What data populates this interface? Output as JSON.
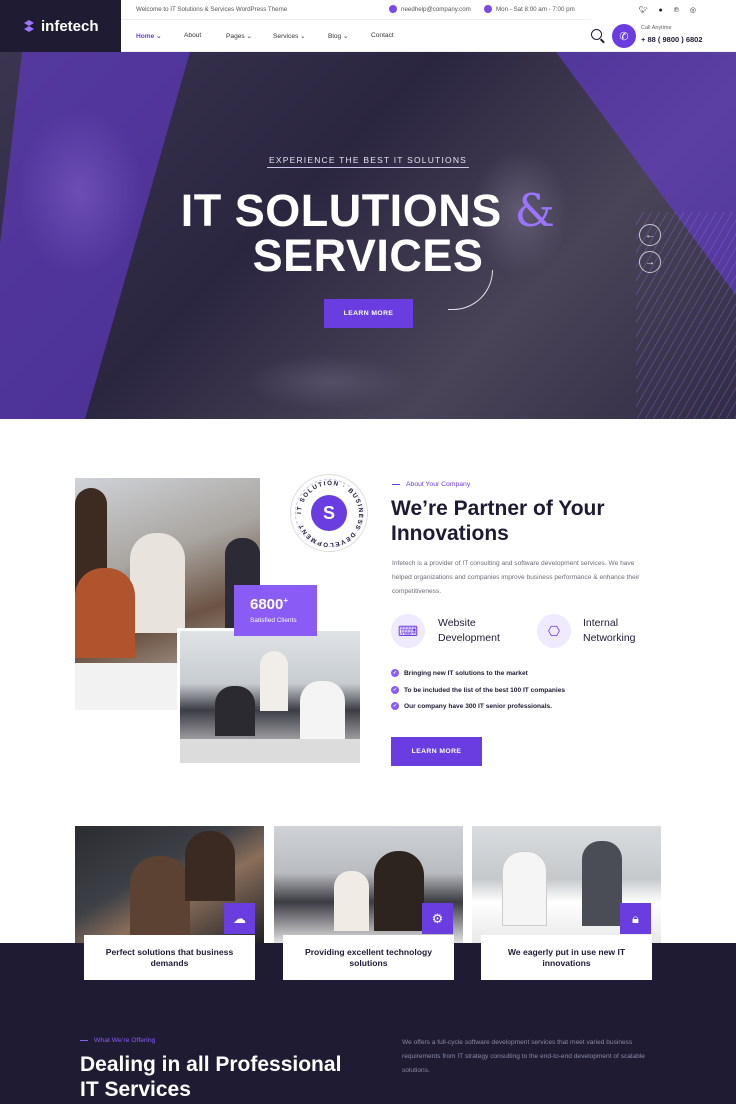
{
  "brand": {
    "logo_text": "infetech"
  },
  "topbar": {
    "welcome": "Welcome to IT Solutions & Services WordPress Theme",
    "email": "needhelp@company.com",
    "hours": "Mon - Sat 8:00 am - 7:00 pm"
  },
  "social": [
    "twitter-icon",
    "facebook-icon",
    "pinterest-icon",
    "instagram-icon"
  ],
  "nav": {
    "items": [
      {
        "label": "Home ⌄"
      },
      {
        "label": "About"
      },
      {
        "label": "Pages ⌄"
      },
      {
        "label": "Services ⌄"
      },
      {
        "label": "Blog ⌄"
      },
      {
        "label": "Contact"
      }
    ],
    "call_label": "Call Anytime",
    "call_number": "+ 88 ( 9800 ) 6802"
  },
  "hero": {
    "kicker": "EXPERIENCE THE BEST IT SOLUTIONS",
    "title_line1": "IT SOLUTIONS",
    "title_amp": "&",
    "title_line2": "SERVICES",
    "button": "LEARN MORE",
    "prev": "←",
    "next": "→"
  },
  "about": {
    "badge_text": "IT SOLUTION · BUSINESS DEVELOPMENT",
    "stat_number": "6800",
    "stat_plus": "+",
    "stat_label": "Satisfied Clients",
    "tag": "About Your Company",
    "title": "We’re Partner of Your Innovations",
    "description": "Infetech is a provider of IT consulting and software development services. We have helped organizations and companies improve business performance & enhance their competitiveness.",
    "features": [
      {
        "title": "Website Development"
      },
      {
        "title": "Internal Networking"
      }
    ],
    "checks": [
      "Bringing new IT solutions to the market",
      "To be included the list of the best 100 IT companies",
      "Our company have 300 IT senior professionals."
    ],
    "button": "LEARN MORE"
  },
  "cards": [
    {
      "title": "Perfect solutions that business demands"
    },
    {
      "title": "Providing excellent technology solutions"
    },
    {
      "title": "We eagerly put in use new IT innovations"
    }
  ],
  "offering": {
    "tag": "What We’re Offering",
    "title": "Dealing in all Professional IT Services",
    "description": "We offers a full-cycle software development services that meet varied business requirements from IT strategy consulting to the end-to-end development of scalable solutions."
  },
  "colors": {
    "accent": "#6a3de0",
    "dark": "#1e1b33"
  }
}
